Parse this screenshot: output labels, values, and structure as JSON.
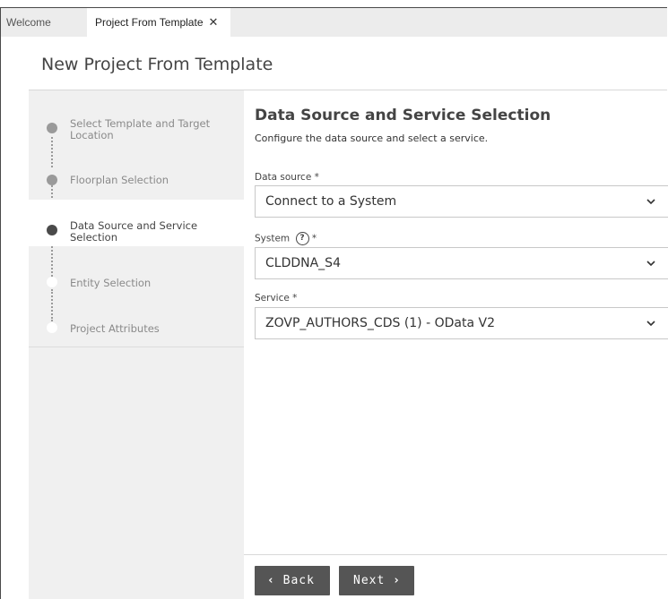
{
  "tabs": {
    "welcome": "Welcome",
    "active": "Project From Template",
    "close_glyph": "✕"
  },
  "page": {
    "title": "New Project From Template"
  },
  "steps": [
    {
      "label": "Select Template and Target Location",
      "state": "done"
    },
    {
      "label": "Floorplan Selection",
      "state": "done"
    },
    {
      "label": "Data Source and Service Selection",
      "state": "current"
    },
    {
      "label": "Entity Selection",
      "state": "todo"
    },
    {
      "label": "Project Attributes",
      "state": "todo"
    }
  ],
  "section": {
    "title": "Data Source and Service Selection",
    "subtitle": "Configure the data source and select a service."
  },
  "fields": {
    "data_source": {
      "label": "Data source *",
      "value": "Connect to a System"
    },
    "system": {
      "label": "System",
      "required_mark": "*",
      "help_glyph": "?",
      "value": "CLDDNA_S4"
    },
    "service": {
      "label": "Service *",
      "value": "ZOVP_AUTHORS_CDS (1) - OData V2"
    }
  },
  "buttons": {
    "back": "Back",
    "back_glyph": "‹",
    "next": "Next",
    "next_glyph": "›"
  },
  "icons": {
    "chevron": "chevron-down-icon",
    "help": "help-circle-icon"
  }
}
